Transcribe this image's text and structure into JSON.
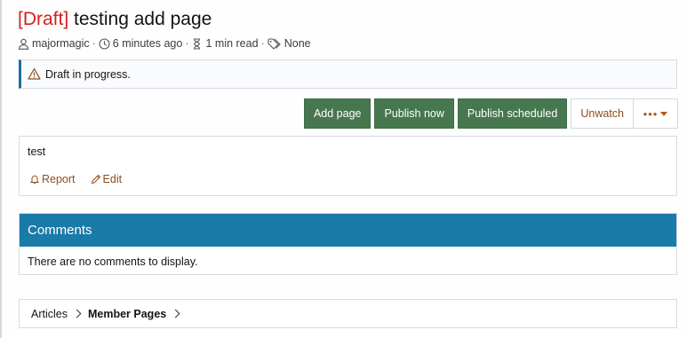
{
  "thread": {
    "prefix": "[Draft]",
    "title": "testing add page"
  },
  "meta": {
    "author": "majormagic",
    "time": "6 minutes ago",
    "read_time": "1 min read",
    "tags": "None",
    "separator": "·"
  },
  "notice": {
    "text": "Draft in progress."
  },
  "buttons": {
    "add_page": "Add page",
    "publish_now": "Publish now",
    "publish_scheduled": "Publish scheduled",
    "unwatch": "Unwatch",
    "more": "•••"
  },
  "post": {
    "body": "test",
    "report": "Report",
    "edit": "Edit"
  },
  "comments": {
    "title": "Comments",
    "empty": "There are no comments to display."
  },
  "breadcrumb": {
    "items": [
      "Articles",
      "Member Pages"
    ]
  },
  "colors": {
    "draft_prefix": "#d52020",
    "accent_blue": "#1a7aa8",
    "button_green": "#47774f",
    "link_brown": "#8d4d21"
  }
}
